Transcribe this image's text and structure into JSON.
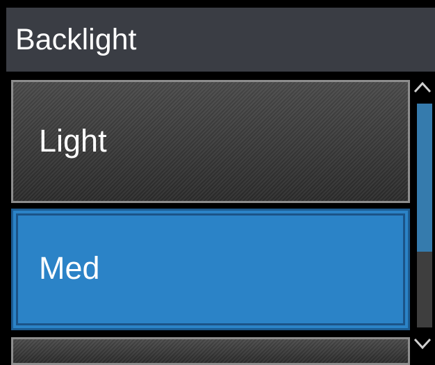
{
  "header": {
    "title": "Backlight"
  },
  "menu": {
    "items": [
      {
        "label": "Light",
        "selected": false
      },
      {
        "label": "Med",
        "selected": true
      },
      {
        "label": "",
        "selected": false
      }
    ]
  },
  "scrollbar": {
    "thumb_fraction": 0.66
  },
  "icons": {
    "scroll_up": "chevron-up-icon",
    "scroll_down": "chevron-down-icon"
  },
  "colors": {
    "selected_bg": "#2b83c7",
    "header_bg": "#3a3d44",
    "scroll_thumb": "#357bad"
  }
}
